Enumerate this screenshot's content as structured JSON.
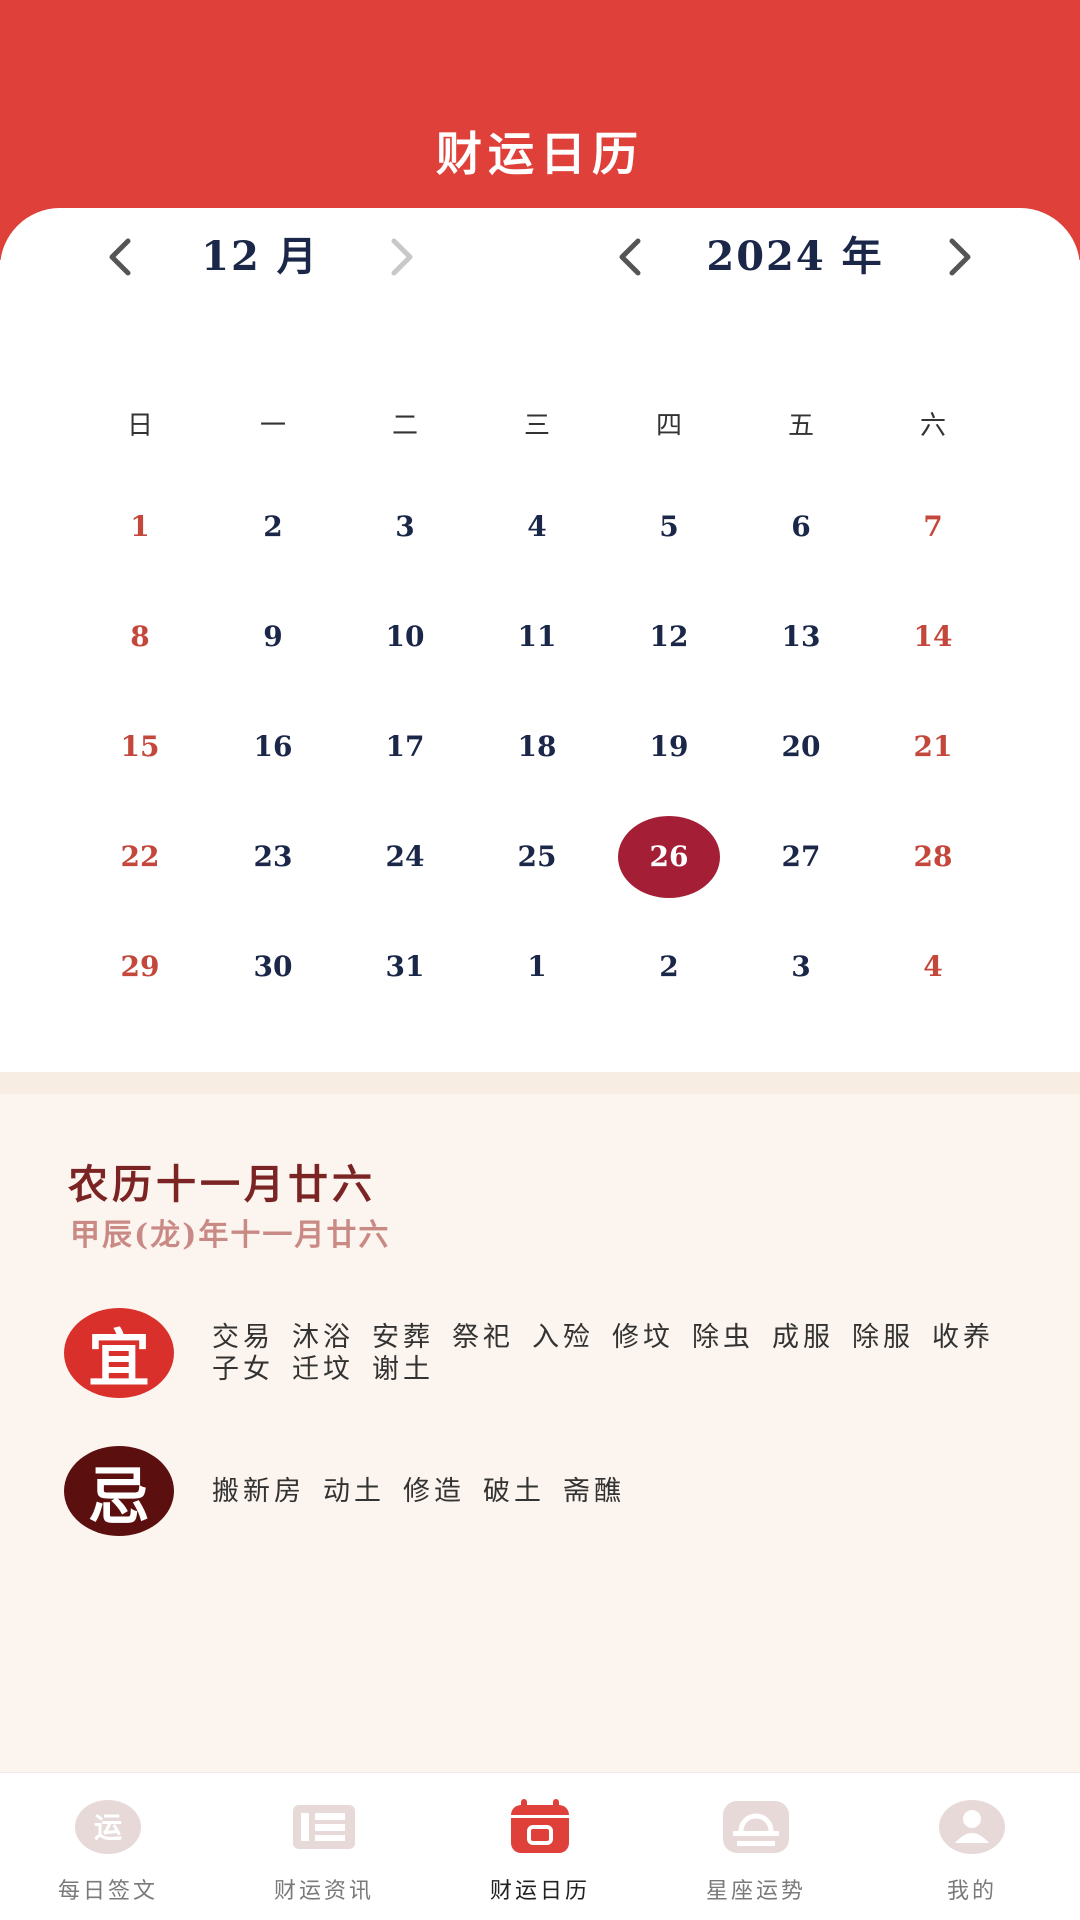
{
  "header": {
    "title": "财运日历"
  },
  "month_nav": {
    "label": "12 月"
  },
  "year_nav": {
    "label": "2024 年"
  },
  "weekdays": [
    "日",
    "一",
    "二",
    "三",
    "四",
    "五",
    "六"
  ],
  "calendar": {
    "weeks": [
      [
        "1",
        "2",
        "3",
        "4",
        "5",
        "6",
        "7"
      ],
      [
        "8",
        "9",
        "10",
        "11",
        "12",
        "13",
        "14"
      ],
      [
        "15",
        "16",
        "17",
        "18",
        "19",
        "20",
        "21"
      ],
      [
        "22",
        "23",
        "24",
        "25",
        "26",
        "27",
        "28"
      ],
      [
        "29",
        "30",
        "31",
        "1",
        "2",
        "3",
        "4"
      ]
    ],
    "selected": "26"
  },
  "lunar": {
    "main": "农历十一月廿六",
    "sub": "甲辰(龙)年十一月廿六"
  },
  "yi": {
    "glyph": "宜",
    "items": [
      "交易",
      "沐浴",
      "安葬",
      "祭祀",
      "入殓",
      "修坟",
      "除虫",
      "成服",
      "除服",
      "收养子女",
      "迁坟",
      "谢土"
    ]
  },
  "ji": {
    "glyph": "忌",
    "items": [
      "搬新房",
      "动土",
      "修造",
      "破土",
      "斋醮"
    ]
  },
  "tabs": [
    {
      "label": "每日签文",
      "icon": "yun-badge-icon"
    },
    {
      "label": "财运资讯",
      "icon": "news-icon"
    },
    {
      "label": "财运日历",
      "icon": "calendar-icon"
    },
    {
      "label": "星座运势",
      "icon": "libra-icon"
    },
    {
      "label": "我的",
      "icon": "user-icon"
    }
  ],
  "colors": {
    "header": "#e0403a",
    "accent": "#a41f35",
    "weekend": "#c4473c",
    "text": "#1b2748"
  }
}
